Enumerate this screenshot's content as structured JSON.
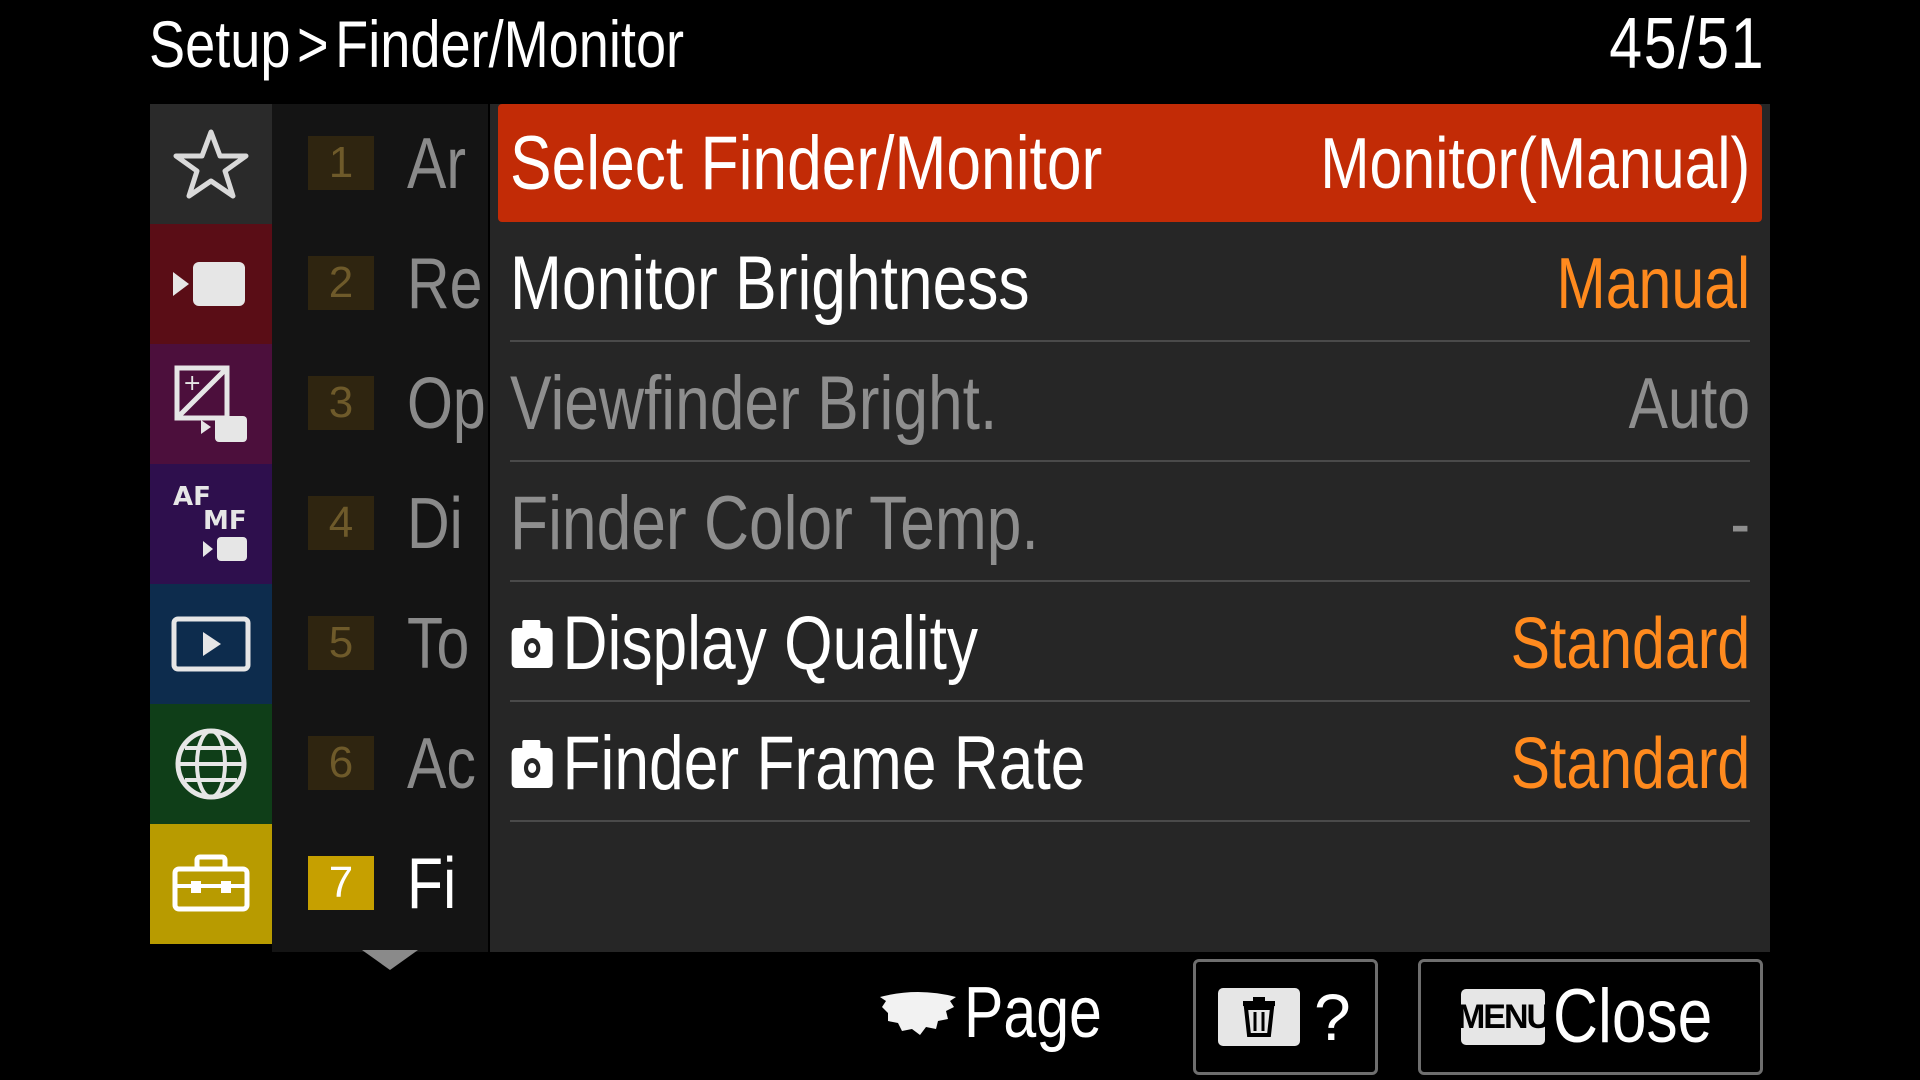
{
  "header": {
    "crumb_parent": "Setup",
    "crumb_separator": ">",
    "crumb_current": "Finder/Monitor",
    "page_counter": "45/51"
  },
  "categories": [
    {
      "icon": "star-icon",
      "color": "#2a2a2a"
    },
    {
      "icon": "movie-camera-icon",
      "color": "#5a0d16"
    },
    {
      "icon": "exposure-color-icon",
      "color": "#4c0f3c"
    },
    {
      "icon": "af-mf-icon",
      "color": "#2e0f4d"
    },
    {
      "icon": "playback-icon",
      "color": "#0d2c4d"
    },
    {
      "icon": "network-globe-icon",
      "color": "#0f3e18"
    },
    {
      "icon": "toolbox-icon",
      "color": "#b89b00"
    }
  ],
  "sublist": {
    "items": [
      {
        "num": "1",
        "text": "Ar"
      },
      {
        "num": "2",
        "text": "Re"
      },
      {
        "num": "3",
        "text": "Op"
      },
      {
        "num": "4",
        "text": "Di"
      },
      {
        "num": "5",
        "text": "To"
      },
      {
        "num": "6",
        "text": "Ac"
      },
      {
        "num": "7",
        "text": "Fi"
      }
    ],
    "active_index": 6
  },
  "menu": {
    "items": [
      {
        "label": "Select Finder/Monitor",
        "value": "Monitor(Manual)",
        "state": "selected",
        "camera_icon": false
      },
      {
        "label": "Monitor Brightness",
        "value": "Manual",
        "state": "enabled",
        "camera_icon": false
      },
      {
        "label": "Viewfinder Bright.",
        "value": "Auto",
        "state": "disabled",
        "camera_icon": false
      },
      {
        "label": "Finder Color Temp.",
        "value": "-",
        "state": "disabled",
        "camera_icon": false
      },
      {
        "label": "Display Quality",
        "value": "Standard",
        "state": "enabled",
        "camera_icon": true
      },
      {
        "label": "Finder Frame Rate",
        "value": "Standard",
        "state": "enabled",
        "camera_icon": true
      }
    ]
  },
  "footer": {
    "page_label": "Page",
    "help_label": "?",
    "menu_badge": "MENU",
    "close_label": "Close"
  },
  "colors": {
    "selected_row": "#c22b06",
    "value_accent": "#ff8a1e",
    "disabled_text": "#8e8e8e"
  }
}
